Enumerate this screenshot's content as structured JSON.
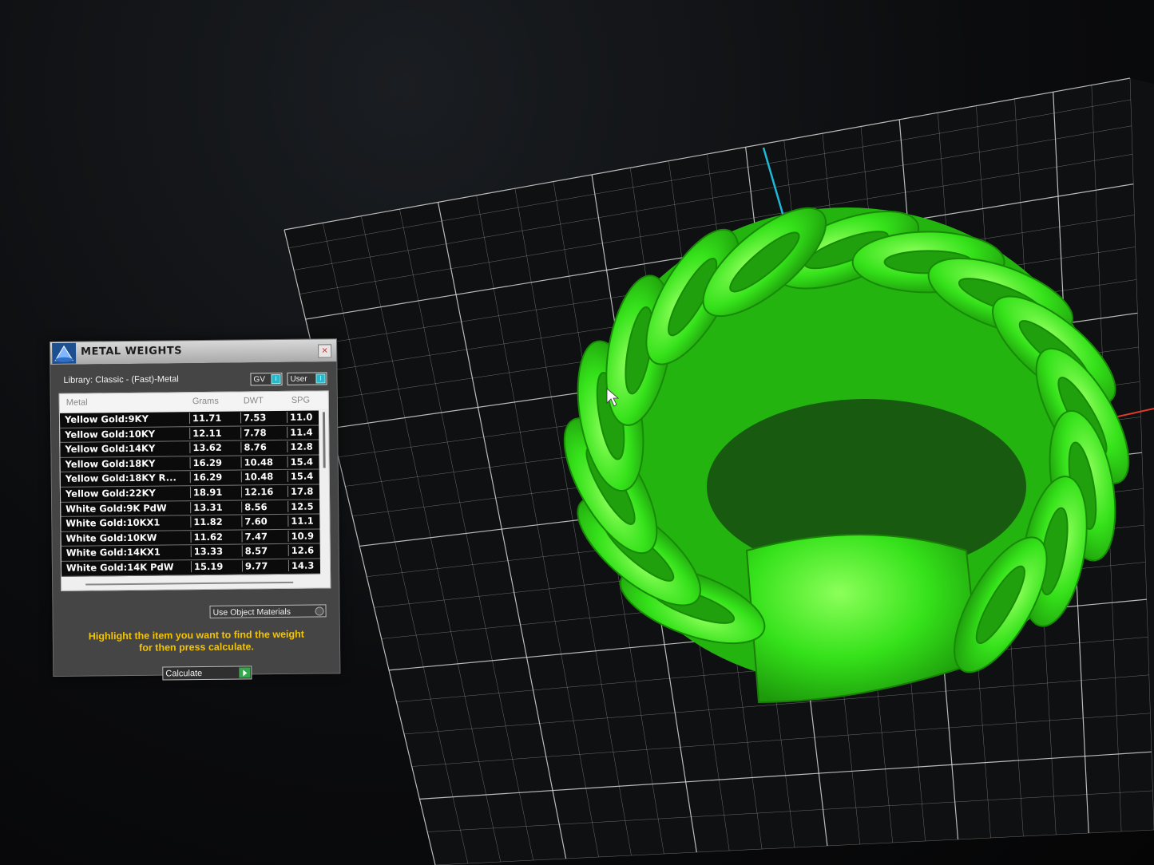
{
  "dialog": {
    "title": "METAL WEIGHTS",
    "library_label": "Library: Classic - (Fast)-Metal",
    "toggles": {
      "gv_label": "GV",
      "user_label": "User",
      "knob_glyph": "I"
    },
    "close_glyph": "×",
    "table": {
      "headers": {
        "metal": "Metal",
        "grams": "Grams",
        "dwt": "DWT",
        "spg": "SPG"
      },
      "rows": [
        {
          "metal": "Yellow Gold:9KY",
          "grams": "11.71",
          "dwt": "7.53",
          "spg": "11.0"
        },
        {
          "metal": "Yellow Gold:10KY",
          "grams": "12.11",
          "dwt": "7.78",
          "spg": "11.4"
        },
        {
          "metal": "Yellow Gold:14KY",
          "grams": "13.62",
          "dwt": "8.76",
          "spg": "12.8"
        },
        {
          "metal": "Yellow Gold:18KY",
          "grams": "16.29",
          "dwt": "10.48",
          "spg": "15.4"
        },
        {
          "metal": "Yellow Gold:18KY R...",
          "grams": "16.29",
          "dwt": "10.48",
          "spg": "15.4"
        },
        {
          "metal": "Yellow Gold:22KY",
          "grams": "18.91",
          "dwt": "12.16",
          "spg": "17.8"
        },
        {
          "metal": "White Gold:9K PdW",
          "grams": "13.31",
          "dwt": "8.56",
          "spg": "12.5"
        },
        {
          "metal": "White Gold:10KX1",
          "grams": "11.82",
          "dwt": "7.60",
          "spg": "11.1"
        },
        {
          "metal": "White Gold:10KW",
          "grams": "11.62",
          "dwt": "7.47",
          "spg": "10.9"
        },
        {
          "metal": "White Gold:14KX1",
          "grams": "13.33",
          "dwt": "8.57",
          "spg": "12.6"
        },
        {
          "metal": "White Gold:14K PdW",
          "grams": "15.19",
          "dwt": "9.77",
          "spg": "14.3"
        }
      ]
    },
    "use_object_materials_label": "Use Object Materials",
    "instruction_line1": "Highlight the item you want to find the weight",
    "instruction_line2": "for then press calculate.",
    "calculate_label": "Calculate"
  },
  "viewport": {
    "grid_color": "#d9d9d9",
    "model_color": "#33e61a",
    "axis_y_color": "#1fb8d6",
    "axis_x_color": "#e03a2a",
    "model_name": "cuban-link-ring"
  }
}
